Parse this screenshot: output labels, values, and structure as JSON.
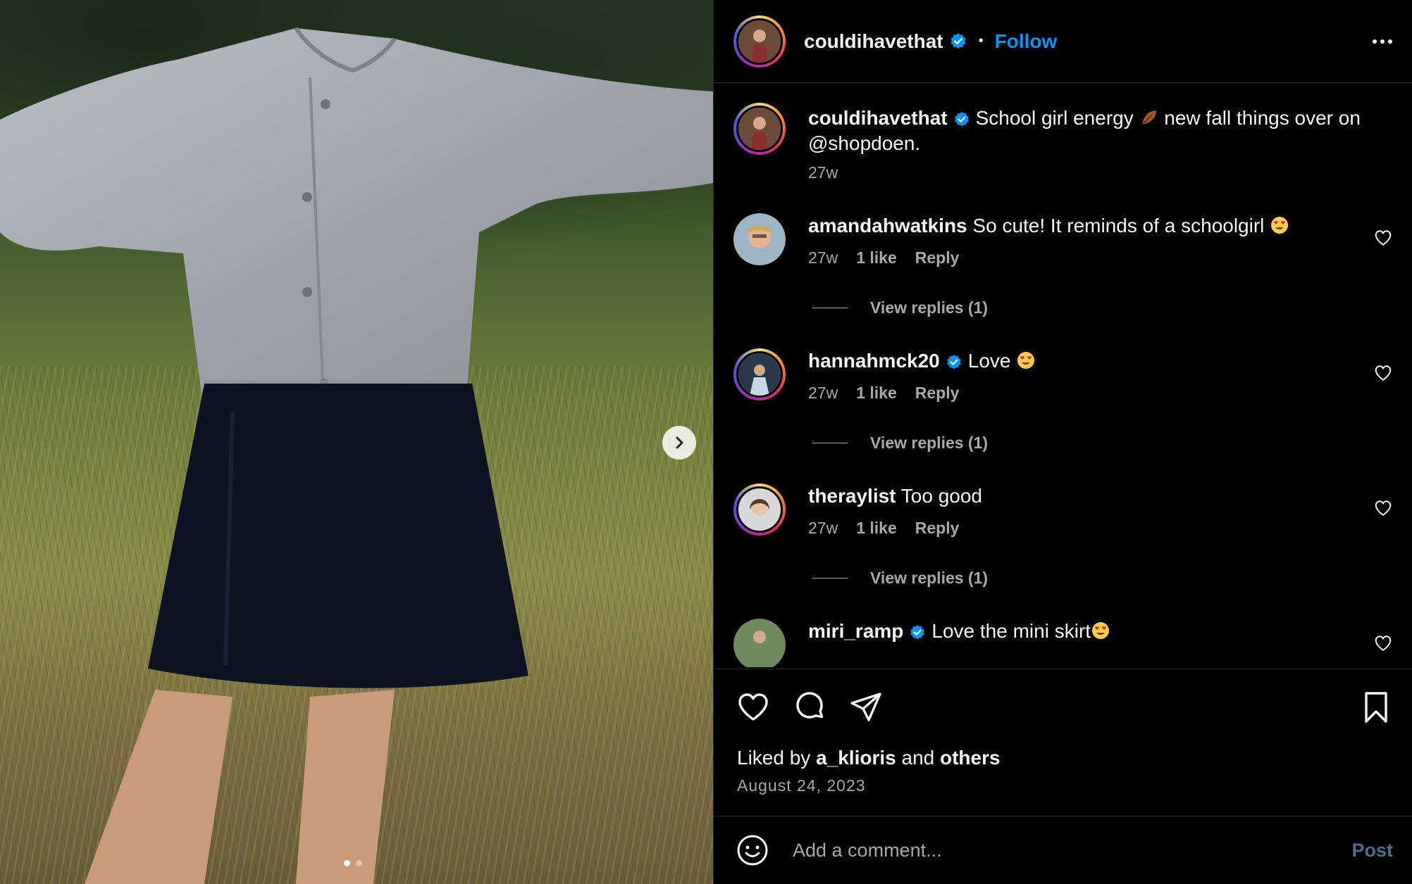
{
  "post": {
    "author": "couldihavethat",
    "follow_label": "Follow",
    "separator": "•",
    "caption_text": "School girl energy",
    "caption_rest": "new fall things over on @shopdoen.",
    "caption_time": "27w"
  },
  "comments": [
    {
      "username": "amandahwatkins",
      "text": "So cute! It reminds of a schoolgirl",
      "verified": false,
      "time": "27w",
      "likes": "1 like",
      "reply_label": "Reply",
      "view_replies": "View replies (1)"
    },
    {
      "username": "hannahmck20",
      "text": "Love",
      "verified": true,
      "time": "27w",
      "likes": "1 like",
      "reply_label": "Reply",
      "view_replies": "View replies (1)"
    },
    {
      "username": "theraylist",
      "text": "Too good",
      "verified": false,
      "time": "27w",
      "likes": "1 like",
      "reply_label": "Reply",
      "view_replies": "View replies (1)"
    },
    {
      "username": "miri_ramp",
      "text": "Love the mini skirt",
      "verified": true
    }
  ],
  "likes": {
    "prefix": "Liked by",
    "user": "a_klioris",
    "conjunction": "and",
    "others": "others"
  },
  "date": "August 24, 2023",
  "comment_input": {
    "placeholder": "Add a comment...",
    "post_label": "Post"
  },
  "carousel": {
    "slide_count": 2,
    "active_index": 0
  },
  "colors": {
    "accent": "#0095f6",
    "background": "#000000",
    "secondary_text": "#a8a8a8",
    "post_disabled": "#4d6e8f"
  },
  "icons": {
    "verified": "verified-badge-icon",
    "heart": "heart-icon",
    "comment": "comment-icon",
    "share": "share-icon",
    "save": "bookmark-icon",
    "emoji": "emoji-icon",
    "more": "more-options-icon",
    "next": "chevron-right-icon"
  }
}
